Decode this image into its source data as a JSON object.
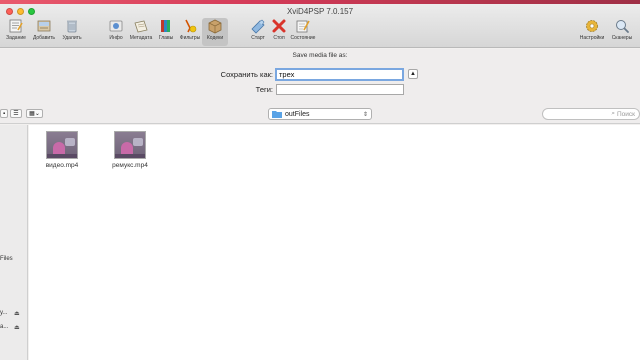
{
  "window": {
    "title": "XviD4PSP 7.0.157"
  },
  "toolbar": {
    "items": [
      {
        "label": "Задание",
        "icon": "task-icon"
      },
      {
        "label": "Добавить",
        "icon": "add-icon"
      },
      {
        "label": "Удалить",
        "icon": "trash-icon"
      },
      {
        "label": "Инфо",
        "icon": "info-icon"
      },
      {
        "label": "Метадата",
        "icon": "metadata-icon"
      },
      {
        "label": "Главы",
        "icon": "chapters-icon"
      },
      {
        "label": "Фильтры",
        "icon": "filters-icon"
      },
      {
        "label": "Кодеки",
        "icon": "codecs-icon"
      },
      {
        "label": "Старт",
        "icon": "start-icon"
      },
      {
        "label": "Стоп",
        "icon": "stop-icon"
      },
      {
        "label": "Состояние",
        "icon": "status-icon"
      },
      {
        "label": "Настройки",
        "icon": "settings-icon"
      },
      {
        "label": "Сканеры",
        "icon": "scanners-icon"
      }
    ]
  },
  "dialog": {
    "title": "Save media file as:",
    "save_as_label": "Сохранить как:",
    "save_as_value": "трех",
    "tags_label": "Теги:",
    "tags_value": ""
  },
  "browser": {
    "current_folder": "outFiles",
    "search_placeholder": "Поиск"
  },
  "sidebar": {
    "items": [
      {
        "label": "Files"
      },
      {
        "label": "у..."
      },
      {
        "label": "а..."
      }
    ]
  },
  "files": [
    {
      "name": "видео.mp4"
    },
    {
      "name": "ремукс.mp4"
    }
  ],
  "colors": {
    "focus_ring": "#7aa7e0",
    "folder_blue": "#5aa3e6",
    "wallpaper": "#d43a58"
  }
}
